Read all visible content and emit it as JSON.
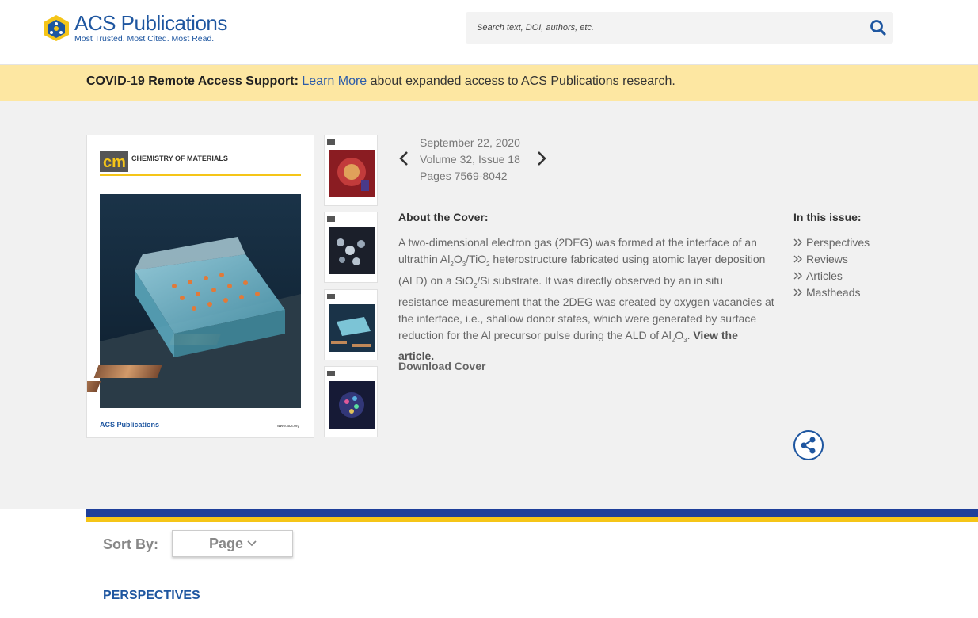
{
  "header": {
    "logo_title": "ACS Publications",
    "logo_tagline": "Most Trusted. Most Cited. Most Read.",
    "search_placeholder": "Search text, DOI, authors, etc.",
    "brand_color": "#1e56a0"
  },
  "banner": {
    "bold": "COVID-19 Remote Access Support:",
    "link": "Learn More",
    "rest": "about expanded access to ACS Publications research.",
    "bg_color": "#fde7a2"
  },
  "cover": {
    "journal_abbr": "cm",
    "journal_name": "CHEMISTRY OF MATERIALS",
    "publisher": "ACS Publications",
    "publisher_tag": "Most Trusted. Most Cited. Most Read.",
    "url": "www.acs.org"
  },
  "issue": {
    "date": "September 22, 2020",
    "volume": "Volume 32, Issue 18",
    "pages": "Pages 7569-8042"
  },
  "about": {
    "heading": "About the Cover:",
    "view_link": "View the article.",
    "download": "Download Cover"
  },
  "in_issue": {
    "heading": "In this issue:",
    "items": [
      "Perspectives",
      "Reviews",
      "Articles",
      "Mastheads"
    ]
  },
  "sort": {
    "label": "Sort By:",
    "value": "Page"
  },
  "section": {
    "heading": "PERSPECTIVES"
  }
}
